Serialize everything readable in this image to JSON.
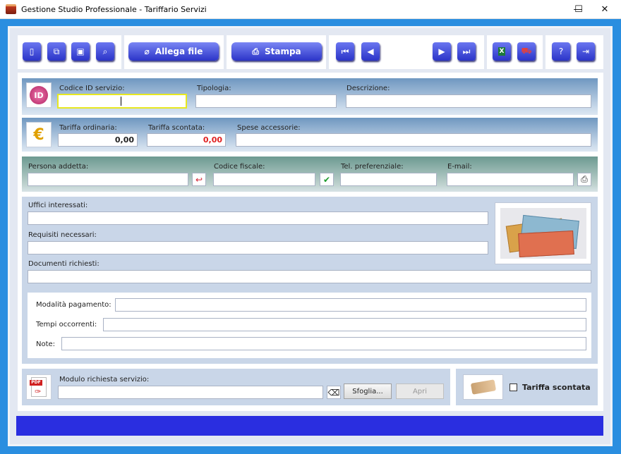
{
  "window": {
    "title": "Gestione Studio Professionale - Tariffario Servizi",
    "minimize": "—",
    "maximize": "☐",
    "close": "✕"
  },
  "toolbar": {
    "attach_label": "Allega file",
    "print_label": "Stampa"
  },
  "section_id": {
    "code_label": "Codice ID servizio:",
    "code_value": "",
    "type_label": "Tipologia:",
    "type_value": "",
    "desc_label": "Descrizione:",
    "desc_value": ""
  },
  "section_fee": {
    "ordinary_label": "Tariffa ordinaria:",
    "ordinary_value": "0,00",
    "discount_label": "Tariffa scontata:",
    "discount_value": "0,00",
    "extra_label": "Spese accessorie:",
    "extra_value": ""
  },
  "section_person": {
    "person_label": "Persona addetta:",
    "person_value": "",
    "cf_label": "Codice fiscale:",
    "cf_value": "",
    "tel_label": "Tel. preferenziale:",
    "tel_value": "",
    "email_label": "E-mail:",
    "email_value": ""
  },
  "section_details": {
    "offices_label": "Uffici interessati:",
    "requirements_label": "Requisiti necessari:",
    "documents_label": "Documenti richiesti:"
  },
  "section_payment": {
    "payment_label": "Modalità pagamento:",
    "time_label": "Tempi occorrenti:",
    "notes_label": "Note:"
  },
  "section_module": {
    "module_label": "Modulo richiesta servizio:",
    "module_value": "",
    "browse_label": "Sfoglia...",
    "open_label": "Apri"
  },
  "discount_check": {
    "label": "Tariffa scontata",
    "checked": false
  },
  "colors": {
    "accent": "#2b34c8",
    "window_border": "#2a8ee0",
    "status_bar": "#2a2ee0",
    "discount_value": "#e02020"
  }
}
